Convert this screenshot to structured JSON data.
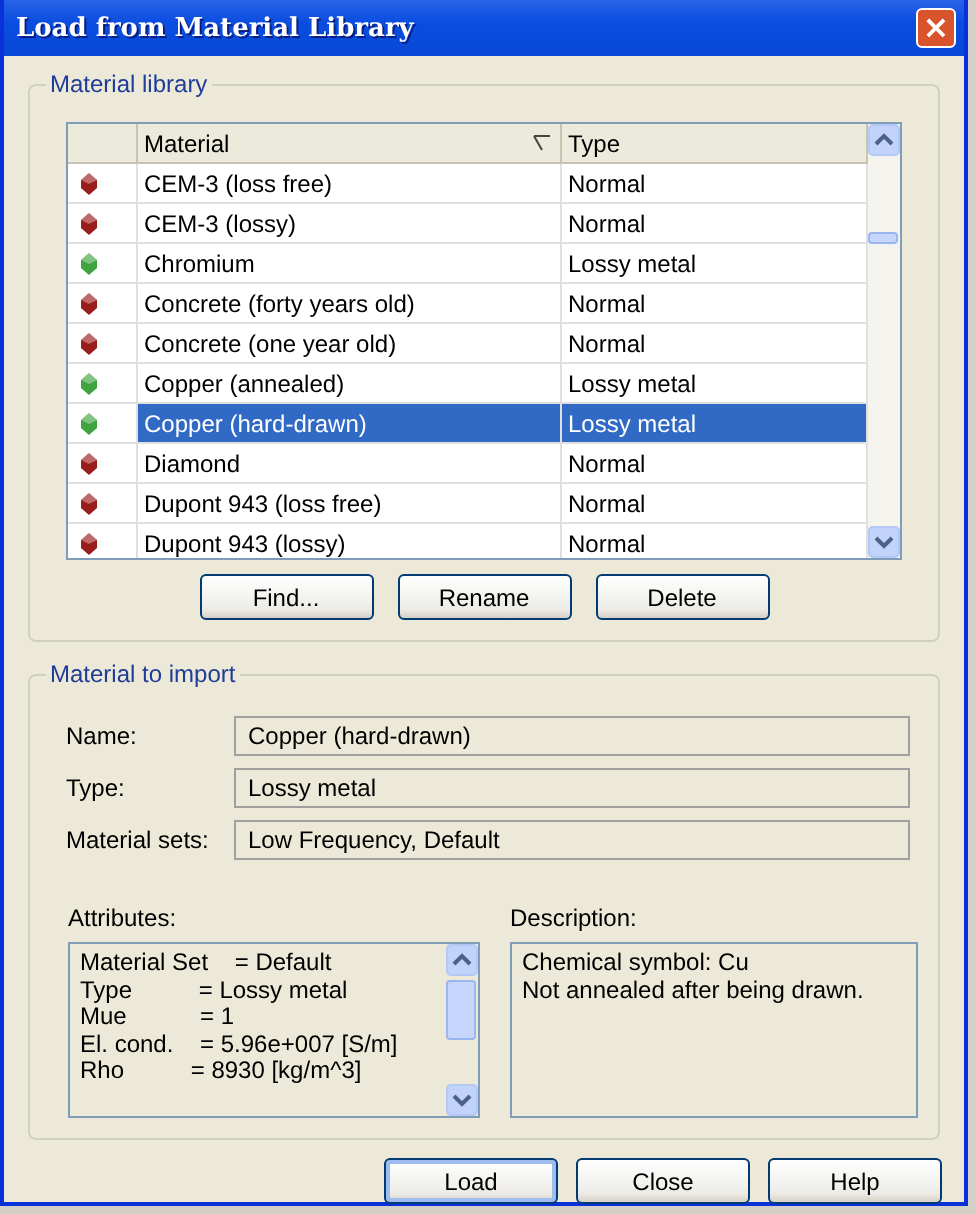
{
  "window": {
    "title": "Load from Material Library",
    "close": "×"
  },
  "library": {
    "title": "Material library",
    "columns": [
      {
        "label": "Material",
        "sort_icon": true
      },
      {
        "label": "Type",
        "sort_icon": false
      }
    ],
    "rows": [
      {
        "material": "CEM-3 (loss free)",
        "type": "Normal",
        "color": "#9b1c1c",
        "selected": false
      },
      {
        "material": "CEM-3 (lossy)",
        "type": "Normal",
        "color": "#9b1c1c",
        "selected": false
      },
      {
        "material": "Chromium",
        "type": "Lossy metal",
        "color": "#3fa43f",
        "selected": false
      },
      {
        "material": "Concrete (forty years old)",
        "type": "Normal",
        "color": "#9b1c1c",
        "selected": false
      },
      {
        "material": "Concrete (one year old)",
        "type": "Normal",
        "color": "#9b1c1c",
        "selected": false
      },
      {
        "material": "Copper (annealed)",
        "type": "Lossy metal",
        "color": "#3fa43f",
        "selected": false
      },
      {
        "material": "Copper (hard-drawn)",
        "type": "Lossy metal",
        "color": "#3fa43f",
        "selected": true
      },
      {
        "material": "Diamond",
        "type": "Normal",
        "color": "#9b1c1c",
        "selected": false
      },
      {
        "material": "Dupont 943 (loss free)",
        "type": "Normal",
        "color": "#9b1c1c",
        "selected": false
      },
      {
        "material": "Dupont 943 (lossy)",
        "type": "Normal",
        "color": "#9b1c1c",
        "selected": false
      }
    ],
    "buttons": [
      "Find...",
      "Rename",
      "Delete"
    ]
  },
  "import": {
    "title": "Material to import",
    "fields": [
      {
        "label": "Name:",
        "value": "Copper (hard-drawn)"
      },
      {
        "label": "Type:",
        "value": "Lossy metal"
      },
      {
        "label": "Material sets:",
        "value": "Low Frequency, Default"
      }
    ],
    "attributes": {
      "label": "Attributes:",
      "lines": [
        "Material Set    = Default",
        "Type          = Lossy metal",
        "Mue           = 1",
        "El. cond.    = 5.96e+007 [S/m]",
        "Rho          = 8930 [kg/m^3]"
      ]
    },
    "description": {
      "label": "Description:",
      "lines": [
        "Chemical symbol: Cu",
        "Not annealed after being drawn."
      ]
    }
  },
  "buttons": [
    {
      "label": "Load",
      "default": true
    },
    {
      "label": "Close",
      "default": false
    },
    {
      "label": "Help",
      "default": false
    }
  ]
}
